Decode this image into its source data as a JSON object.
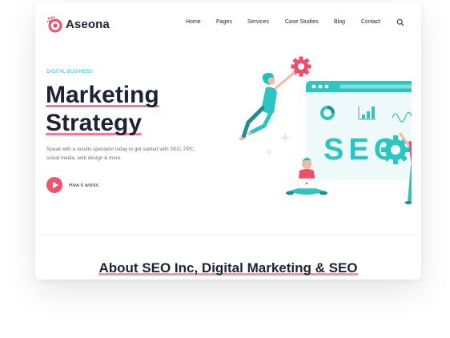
{
  "brand": {
    "name": "Aseona",
    "accent": "#ef4e6b",
    "teal": "#1fbdbc"
  },
  "nav": {
    "items": [
      "Home",
      "Pages",
      "Services",
      "Case Studies",
      "Blog",
      "Contact"
    ],
    "search_icon": "search-icon"
  },
  "hero": {
    "eyebrow": "DIGITAL BUSINESS",
    "title_line1": "Marketing",
    "title_line2": "Strategy",
    "description": "Speak with a results specialist today to get started with SEO, PPC, social media, web design & more.",
    "cta_label": "How it works",
    "illustration_text": "SEO"
  },
  "about": {
    "title": "About SEO Inc, Digital Marketing & SEO"
  }
}
